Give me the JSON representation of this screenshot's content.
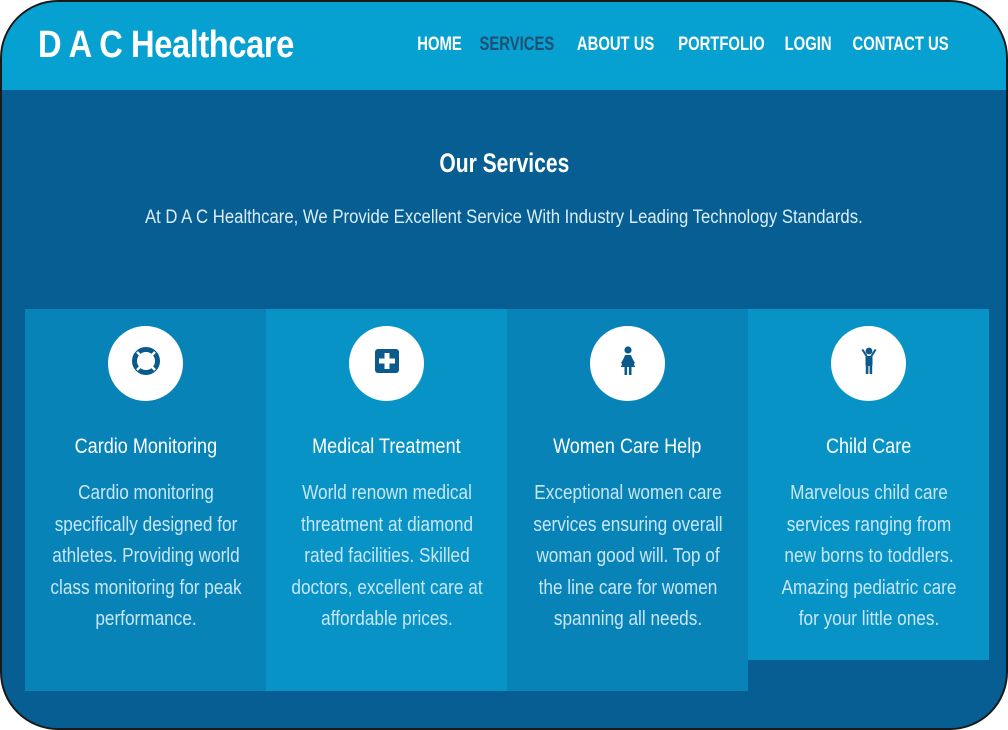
{
  "brand": "D A C Healthcare",
  "nav": [
    "HOME",
    "SERVICES",
    "ABOUT US",
    "PORTFOLIO",
    "LOGIN",
    "CONTACT US"
  ],
  "section": {
    "title": "Our Services",
    "subtitle": "At D A C Healthcare, We Provide Excellent Service With Industry Leading Technology Standards."
  },
  "services": [
    {
      "icon": "lifebuoy-icon",
      "title": "Cardio Monitoring",
      "text": "Cardio monitoring specifically designed for athletes. Providing world class monitoring for peak performance."
    },
    {
      "icon": "medical-plus-icon",
      "title": "Medical Treatment",
      "text": "World renown medical threatment at diamond rated facilities. Skilled doctors, excellent care at affordable prices."
    },
    {
      "icon": "woman-icon",
      "title": "Women Care Help",
      "text": "Exceptional women care services ensuring overall woman good will. Top of the line care for women spanning all needs."
    },
    {
      "icon": "child-icon",
      "title": "Child Care",
      "text": "Marvelous child care services ranging from new borns to toddlers. Amazing pediatric care for your little ones."
    }
  ],
  "colors": {
    "header": "#06a1d0",
    "body": "#065e92",
    "nav_active": "#1f4f73",
    "icon": "#0b5a8c"
  }
}
